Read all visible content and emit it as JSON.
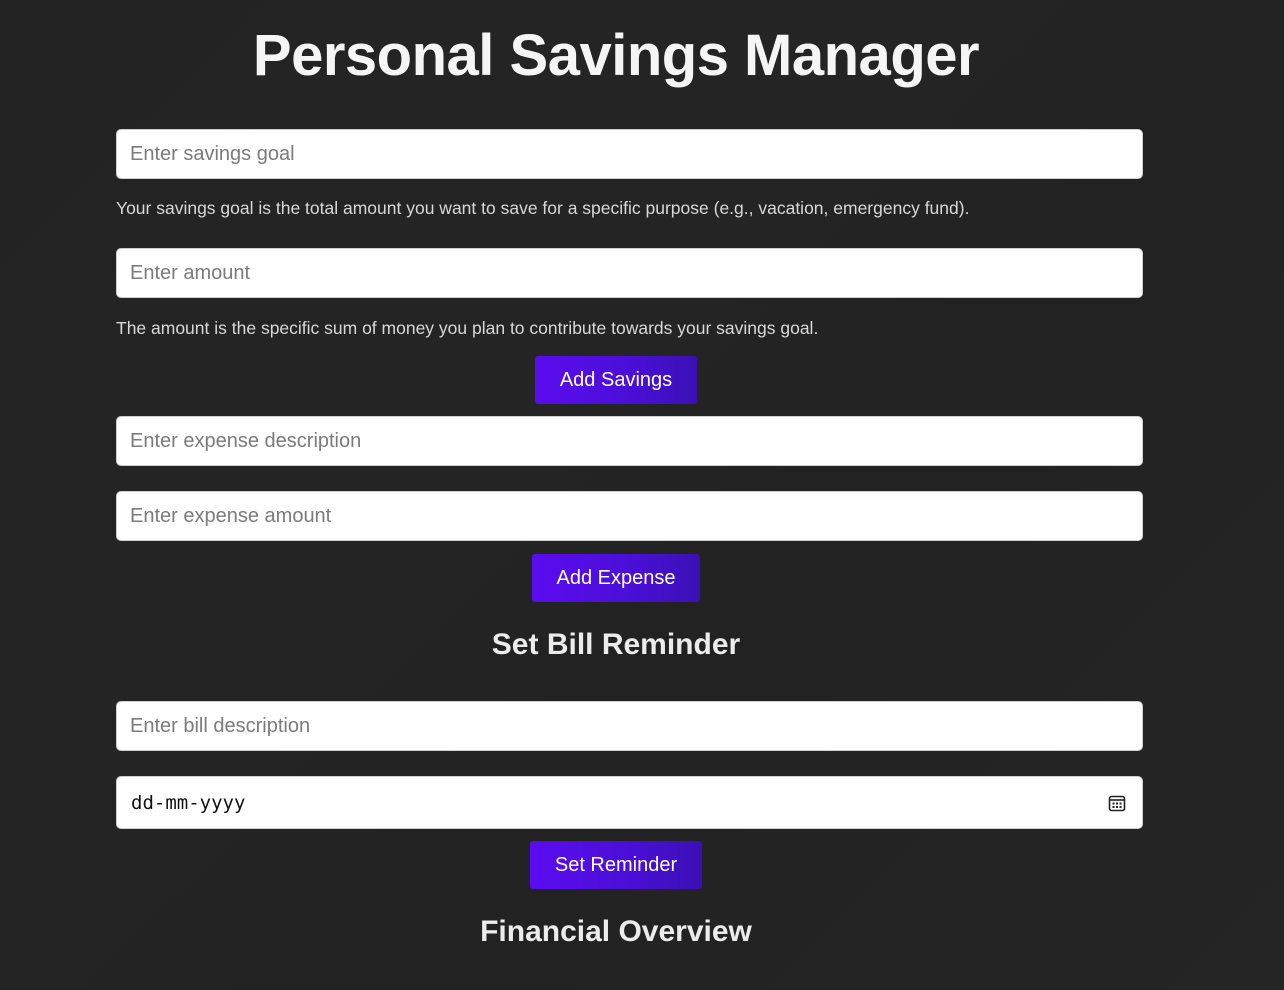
{
  "page": {
    "title": "Personal Savings Manager"
  },
  "savings": {
    "goal_placeholder": "Enter savings goal",
    "goal_help": "Your savings goal is the total amount you want to save for a specific purpose (e.g., vacation, emergency fund).",
    "amount_placeholder": "Enter amount",
    "amount_help": "The amount is the specific sum of money you plan to contribute towards your savings goal.",
    "add_button": "Add Savings"
  },
  "expense": {
    "description_placeholder": "Enter expense description",
    "amount_placeholder": "Enter expense amount",
    "add_button": "Add Expense"
  },
  "bill_reminder": {
    "heading": "Set Bill Reminder",
    "description_placeholder": "Enter bill description",
    "date_placeholder": "dd-mm-yyyy",
    "date_icon": "calendar-icon",
    "set_button": "Set Reminder"
  },
  "overview": {
    "heading": "Financial Overview"
  },
  "colors": {
    "background": "#232323",
    "button_start": "#5a0cf0",
    "button_end": "#3a10b5",
    "text_light": "#f5f5f5"
  }
}
